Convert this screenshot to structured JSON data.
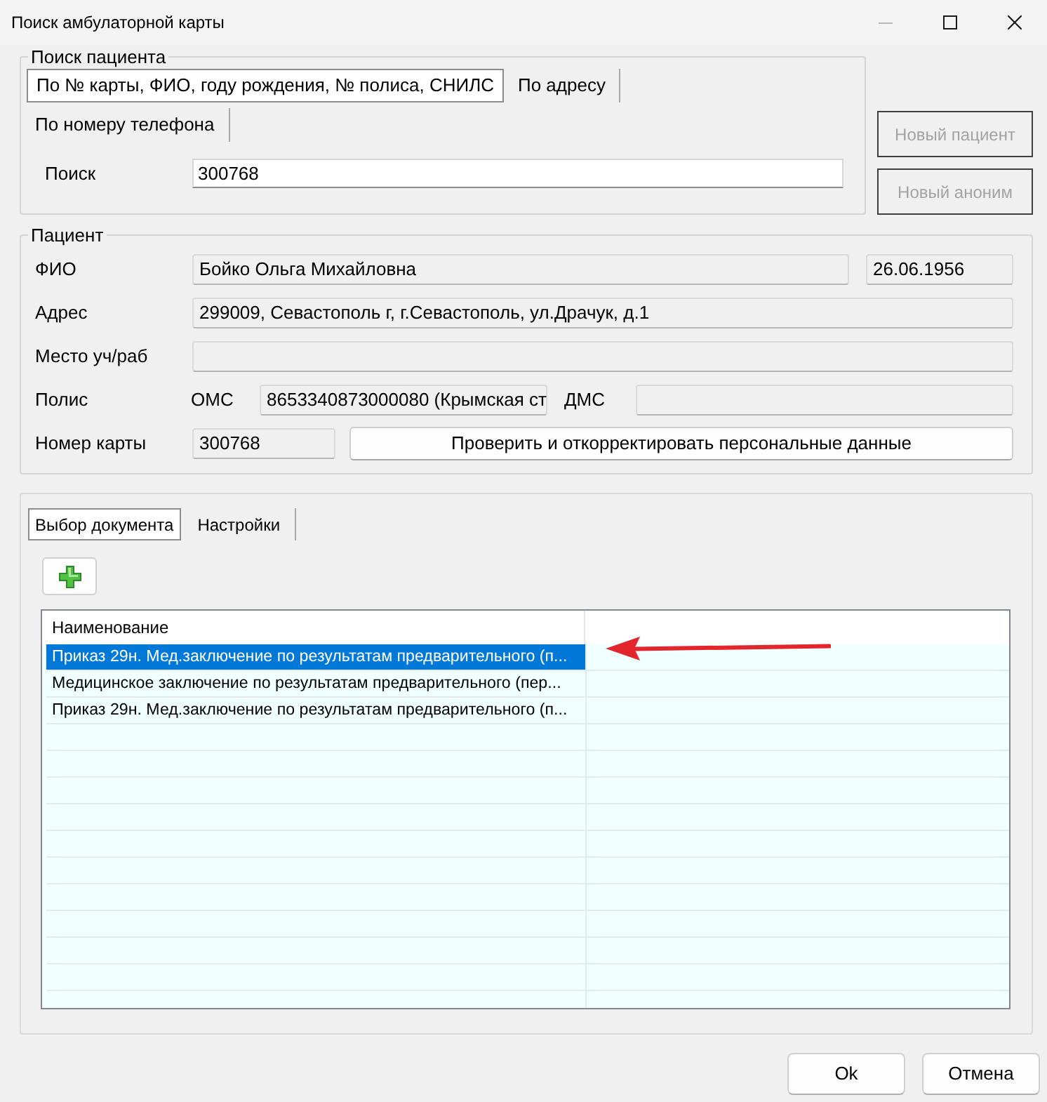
{
  "window": {
    "title": "Поиск амбулаторной карты",
    "controls": [
      {
        "kind": "minimize",
        "disabled": true
      },
      {
        "kind": "maximize",
        "disabled": false
      },
      {
        "kind": "close",
        "disabled": false
      }
    ]
  },
  "search_group": {
    "title": "Поиск пациента",
    "tabs": [
      {
        "label": "По № карты, ФИО, году рождения, № полиса, СНИЛС",
        "selected": true
      },
      {
        "label": "По адресу",
        "selected": false
      },
      {
        "label": "По номеру телефона",
        "selected": false
      }
    ],
    "search": {
      "label": "Поиск",
      "value": "300768"
    }
  },
  "side_buttons": [
    {
      "label": "Новый пациент",
      "disabled": true
    },
    {
      "label": "Новый аноним",
      "disabled": true
    }
  ],
  "patient": {
    "title": "Пациент",
    "full_name": {
      "label": "ФИО",
      "value": "Бойко Ольга Михайловна"
    },
    "birth_date": {
      "value": "26.06.1956"
    },
    "address": {
      "label": "Адрес",
      "value": "299009, Севастополь г, г.Севастополь, ул.Драчук, д.1"
    },
    "workplace": {
      "label": "Место уч/раб"
    },
    "policy": {
      "label": "Полис",
      "oms": {
        "label": "ОМС",
        "value": "8653340873000080 (Крымская ст"
      },
      "dms": {
        "label": "ДМС"
      }
    },
    "card_number": {
      "label": "Номер карты",
      "value": "300768"
    },
    "verify_button": {
      "label": "Проверить и откорректировать персональные данные"
    }
  },
  "documents": {
    "tabs": [
      {
        "label": "Выбор документа",
        "selected": true
      },
      {
        "label": "Настройки",
        "selected": false
      }
    ],
    "table": {
      "columns": [
        "Наименование"
      ],
      "rows": [
        {
          "name": "Приказ 29н. Мед.заключение по результатам предварительного (п...",
          "selected": true
        },
        {
          "name": "Медицинское заключение по результатам предварительного (пер...",
          "selected": false
        },
        {
          "name": "Приказ 29н. Мед.заключение по результатам предварительного (п...",
          "selected": false
        }
      ]
    }
  },
  "footer_buttons": [
    "Ok",
    "Отмена"
  ]
}
